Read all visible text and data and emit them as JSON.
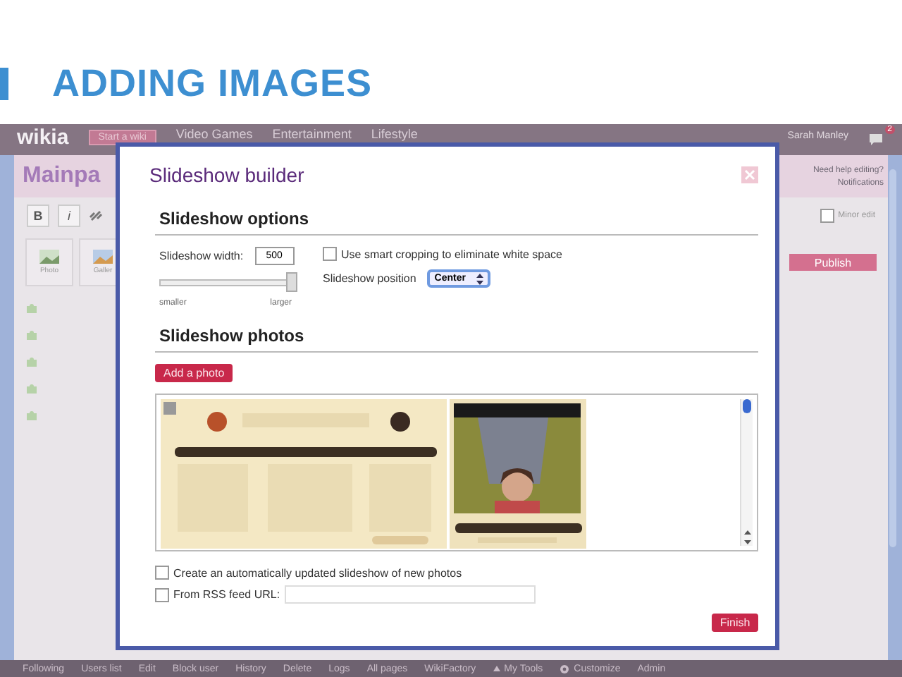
{
  "slide": {
    "title": "ADDING IMAGES"
  },
  "top_nav": {
    "logo": "wikia",
    "start_button": "Start a wiki",
    "menus": [
      "Video Games",
      "Entertainment",
      "Lifestyle"
    ],
    "user": "Sarah Manley",
    "notification_count": "2"
  },
  "editor": {
    "page_title": "Mainpa",
    "help_links": [
      "Need help editing?",
      "Notifications"
    ],
    "format_buttons": [
      "B",
      "i"
    ],
    "insert_buttons": [
      {
        "label": "Photo"
      },
      {
        "label": "Galler"
      }
    ],
    "minor_edit": {
      "label": "Minor edit",
      "checked": false
    },
    "publish": "Publish"
  },
  "modal": {
    "title": "Slideshow builder",
    "options_heading": "Slideshow options",
    "width_label": "Slideshow width:",
    "width_value": "500",
    "width_slider": {
      "level": 1.0
    },
    "slider_min": "smaller",
    "slider_max": "larger",
    "smart_crop": {
      "label": "Use smart cropping to eliminate white space",
      "checked": false
    },
    "position_label": "Slideshow position",
    "position_value": "Center",
    "photos_heading": "Slideshow photos",
    "add_button": "Add a photo",
    "auto_update": {
      "label": "Create an automatically updated slideshow of new photos",
      "checked": false
    },
    "rss": {
      "label": "From RSS feed URL:",
      "checked": false
    },
    "finish": "Finish"
  },
  "bottom_bar": [
    {
      "label": "Following",
      "kind": "text"
    },
    {
      "label": "Users list",
      "kind": "text"
    },
    {
      "label": "Edit",
      "kind": "text"
    },
    {
      "label": "Block user",
      "kind": "text"
    },
    {
      "label": "History",
      "kind": "text"
    },
    {
      "label": "Delete",
      "kind": "text"
    },
    {
      "label": "Logs",
      "kind": "text"
    },
    {
      "label": "All pages",
      "kind": "text"
    },
    {
      "label": "WikiFactory",
      "kind": "text"
    },
    {
      "label": "My Tools",
      "kind": "menu"
    },
    {
      "label": "Customize",
      "kind": "settings"
    },
    {
      "label": "Admin",
      "kind": "text"
    }
  ]
}
